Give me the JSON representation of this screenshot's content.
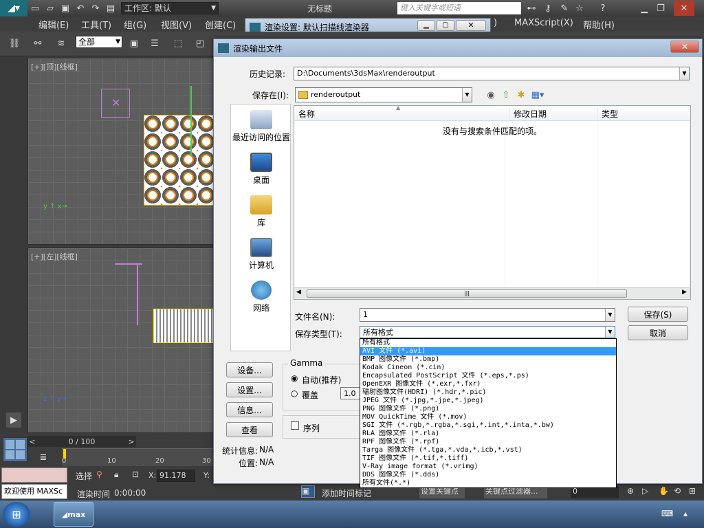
{
  "app": {
    "workspace": "工作区: 默认",
    "doc_title": "无标题",
    "search_placeholder": "键入关键字或短语"
  },
  "menu": [
    "编辑(E)",
    "工具(T)",
    "组(G)",
    "视图(V)",
    "创建(C)",
    "MAXScript(X)",
    "帮助(H)"
  ],
  "menu_partial": ")",
  "toolbar": {
    "selection_filter": "全部"
  },
  "viewports": {
    "top_label": "[+][顶][线框]",
    "left_label": "[+][左][线框]"
  },
  "timeline": {
    "frame": "0 / 100",
    "ticks": [
      "0",
      "10",
      "20",
      "30"
    ]
  },
  "status": {
    "welcome": "欢迎使用 MAXSc",
    "select_label": "选择",
    "x_label": "X:",
    "x_value": "91.178",
    "y_label": "Y:",
    "render_time_label": "渲染时间",
    "render_time": "0:00:00",
    "add_time_tag": "添加时间标记",
    "set_key": "设置关键点",
    "key_filter": "关键点过滤器...",
    "frame_field": "0"
  },
  "render_setup_window": {
    "title": "渲染设置: 默认扫描线渲染器"
  },
  "dialog": {
    "title": "渲染输出文件",
    "history_label": "历史记录:",
    "history_path": "D:\\Documents\\3dsMax\\renderoutput",
    "save_in_label": "保存在(I):",
    "save_in_folder": "renderoutput",
    "places": [
      "最近访问的位置",
      "桌面",
      "库",
      "计算机",
      "网络"
    ],
    "columns": [
      "名称",
      "修改日期",
      "类型"
    ],
    "empty_message": "没有与搜索条件匹配的项。",
    "filename_label": "文件名(N):",
    "filename_value": "1",
    "filetype_label": "保存类型(T):",
    "filetype_value": "所有格式",
    "save_button": "保存(S)",
    "cancel_button": "取消",
    "side_buttons": [
      "设备...",
      "设置...",
      "信息...",
      "查看"
    ],
    "gamma_title": "Gamma",
    "gamma_auto": "自动(推荐)",
    "gamma_override": "覆盖",
    "gamma_value": "1.0",
    "sequence_label": "序列",
    "stats_label": "统计信息:",
    "stats_value": "N/A",
    "location_label": "位置:",
    "location_value": "N/A",
    "filetype_options": [
      "所有格式",
      "AVI 文件 (*.avi)",
      "BMP 图像文件 (*.bmp)",
      "Kodak Cineon (*.cin)",
      "Encapsulated PostScript 文件 (*.eps,*.ps)",
      "OpenEXR 图像文件 (*.exr,*.fxr)",
      "辐射图像文件(HDRI) (*.hdr,*.pic)",
      "JPEG 文件 (*.jpg,*.jpe,*.jpeg)",
      "PNG 图像文件 (*.png)",
      "MOV QuickTime 文件 (*.mov)",
      "SGI 文件 (*.rgb,*.rgba,*.sgi,*.int,*.inta,*.bw)",
      "RLA 图像文件 (*.rla)",
      "RPF 图像文件 (*.rpf)",
      "Targa 图像文件 (*.tga,*.vda,*.icb,*.vst)",
      "TIF 图像文件 (*.tif,*.tiff)",
      "V-Ray image format (*.vrimg)",
      "DDS 图像文件 (*.dds)",
      "所有文件(*.*)"
    ],
    "selected_option_index": 1
  },
  "colors": {
    "selection": "#3399ff",
    "dialog_bg": "#f0f0f0",
    "max_ui": "#454545"
  }
}
